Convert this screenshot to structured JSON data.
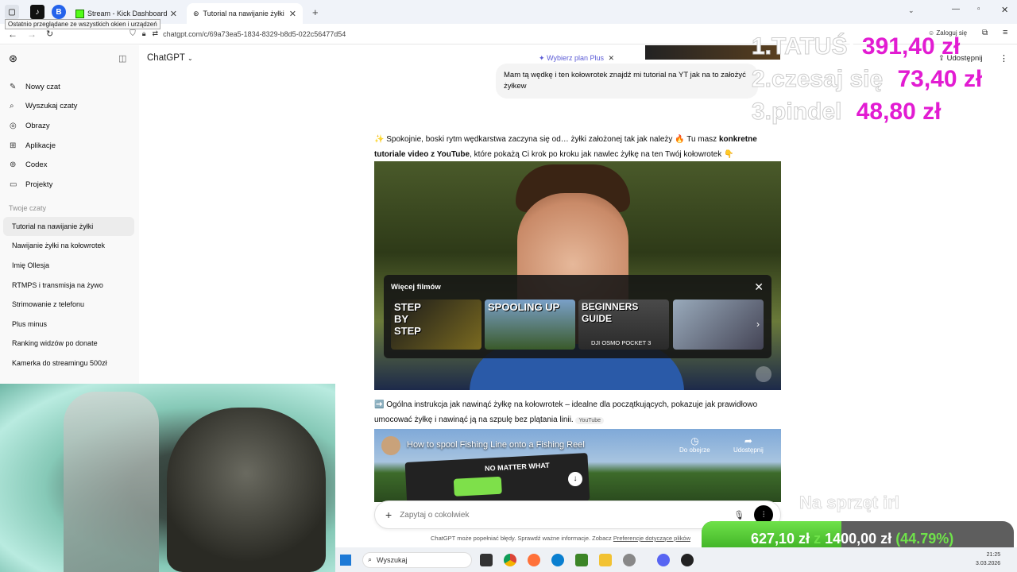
{
  "tabs": [
    {
      "icon": "tiktok-icon",
      "label": ""
    },
    {
      "icon": "app-icon",
      "label": ""
    },
    {
      "icon": "kick-icon",
      "label": "Stream - Kick Dashboard"
    },
    {
      "icon": "chatgpt-icon",
      "label": "Tutorial na nawijanie żyłki"
    }
  ],
  "tooltip": "Ostatnio przeglądane ze wszystkich okien i urządzeń",
  "address": {
    "url": "chatgpt.com/c/69a73ea5-1834-8329-b8d5-022c56477d54",
    "login": "Zaloguj się"
  },
  "sidebar": {
    "items": [
      {
        "icon": "edit-icon",
        "label": "Nowy czat"
      },
      {
        "icon": "search-icon",
        "label": "Wyszukaj czaty"
      },
      {
        "icon": "image-icon",
        "label": "Obrazy"
      },
      {
        "icon": "apps-icon",
        "label": "Aplikacje"
      },
      {
        "icon": "codex-icon",
        "label": "Codex"
      },
      {
        "icon": "folder-icon",
        "label": "Projekty"
      }
    ],
    "section": "Twoje czaty",
    "chats": [
      "Tutorial na nawijanie żyłki",
      "Nawijanie żyłki na kołowrotek",
      "Imię Ollesja",
      "RTMPS i transmisja na żywo",
      "Strimowanie z telefonu",
      "Plus minus",
      "Ranking widzów po donate",
      "Kamerka do streamingu 500zł"
    ]
  },
  "header": {
    "model": "ChatGPT",
    "plus": "Wybierz plan Plus",
    "share": "Udostępnij"
  },
  "ranking": [
    {
      "pos": "1.",
      "name": "TATUŚ",
      "amount": "391,40 zł"
    },
    {
      "pos": "2.",
      "name": "czesaj się",
      "amount": "73,40 zł"
    },
    {
      "pos": "3.",
      "name": "pindel",
      "amount": "48,80 zł"
    }
  ],
  "user_message": "Mam tą wędkę i ten kołowrotek znajdź mi tutorial na YT jak na to założyć żyłkew",
  "assistant": {
    "intro_a": "✨ Spokojnie, boski rytm wędkarstwa zaczyna się od… żyłki założonej tak jak należy 🔥 Tu masz ",
    "intro_bold": "konkretne tutoriale video z YouTube",
    "intro_b": ", które pokażą Ci krok po kroku jak nawlec żyłkę na ten Twój kołowrotek 👇",
    "more_videos": "Więcej filmów",
    "thumbs": [
      "STEP BY STEP",
      "SPOOLING UP",
      "BEGINNERS GUIDE",
      ""
    ],
    "thumb3_sub": "DJI OSMO POCKET 3",
    "desc": "➡️ Ogólna instrukcja jak nawinąć żyłkę na kołowrotek – idealne dla początkujących, pokazuje jak prawidłowo umocować żyłkę i nawinąć ją na szpulę bez plątania linii.",
    "source": "YouTube",
    "video2_title": "How to spool Fishing Line onto a Fishing Reel",
    "watch_later": "Do obejrze",
    "share": "Udostępnij",
    "banner": "NO MATTER WHAT"
  },
  "composer": {
    "placeholder": "Zapytaj o cokolwiek"
  },
  "disclaimer": "ChatGPT może popełniać błędy. Sprawdź ważne informacje. Zobacz",
  "disclaimer_link": "Preferencje dotyczące plików",
  "goal": {
    "title": "Na sprzęt irl",
    "current": "627,10 zł",
    "sep": "z",
    "target": "1400,00 zł",
    "percent": "(44.79%)",
    "fraction": 0.4479
  },
  "taskbar": {
    "search": "Wyszukaj",
    "time": "21:25",
    "date": "3.03.2026"
  }
}
